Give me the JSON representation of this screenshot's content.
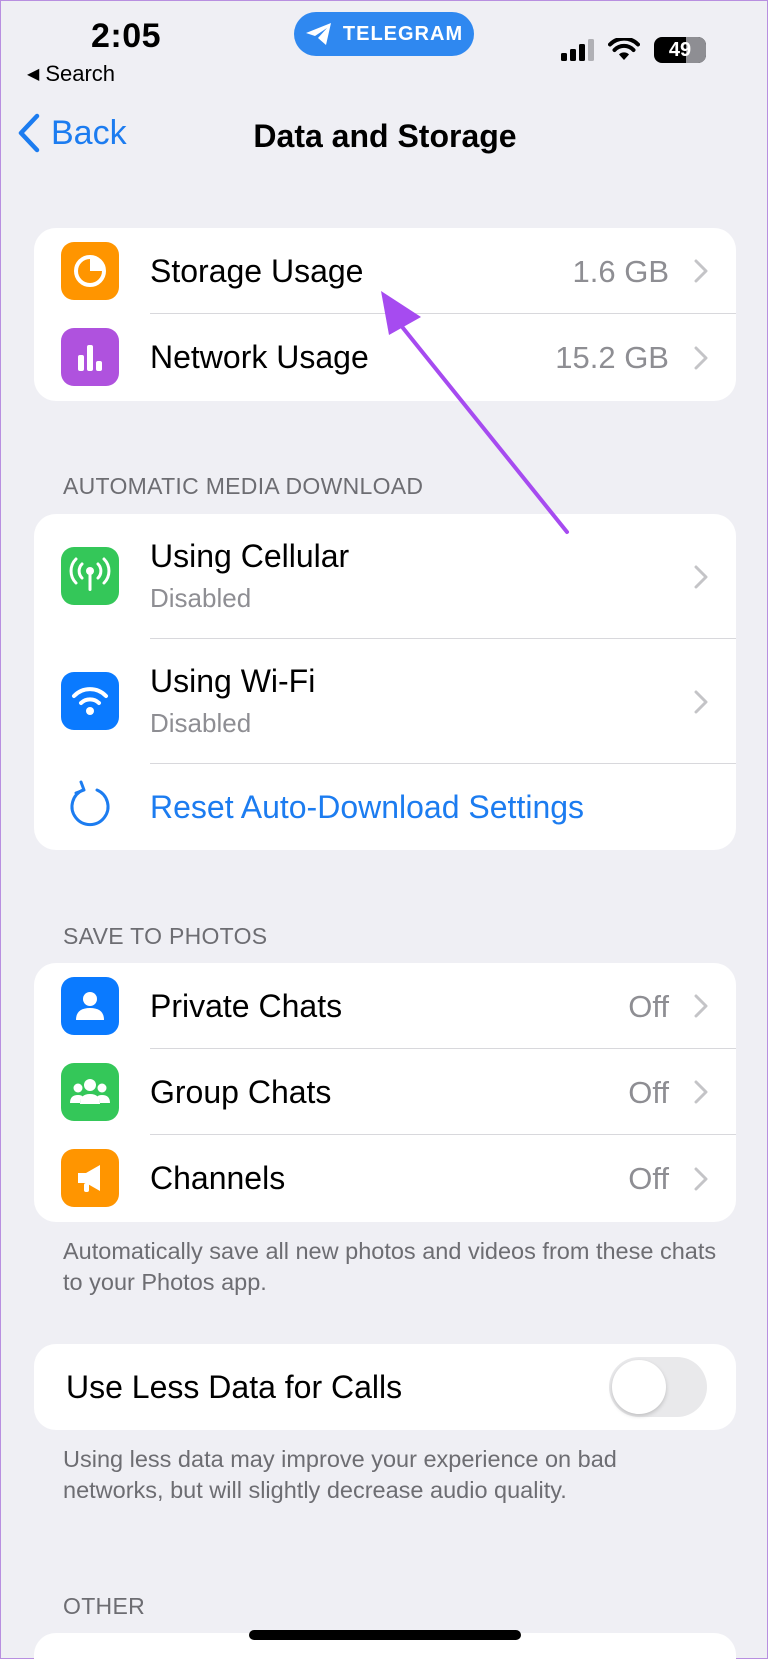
{
  "status_bar": {
    "time": "2:05",
    "back_to_app": "Search",
    "pill_label": "TELEGRAM",
    "battery": "49"
  },
  "nav": {
    "back_label": "Back",
    "title": "Data and Storage"
  },
  "usage": {
    "storage_label": "Storage Usage",
    "storage_value": "1.6 GB",
    "network_label": "Network Usage",
    "network_value": "15.2 GB"
  },
  "auto_download": {
    "header": "AUTOMATIC MEDIA DOWNLOAD",
    "cellular_label": "Using Cellular",
    "cellular_sub": "Disabled",
    "wifi_label": "Using Wi-Fi",
    "wifi_sub": "Disabled",
    "reset_label": "Reset Auto-Download Settings"
  },
  "save_to_photos": {
    "header": "SAVE TO PHOTOS",
    "private_label": "Private Chats",
    "private_value": "Off",
    "group_label": "Group Chats",
    "group_value": "Off",
    "channels_label": "Channels",
    "channels_value": "Off",
    "footnote": "Automatically save all new photos and videos from these chats to your Photos app."
  },
  "calls": {
    "label": "Use Less Data for Calls",
    "toggle_on": false,
    "footnote": "Using less data may improve your experience on bad networks, but will slightly decrease audio quality."
  },
  "other": {
    "header": "OTHER"
  },
  "colors": {
    "accent": "#1c7cf0",
    "storage_icon": "#ff9500",
    "network_icon": "#af52de",
    "cellular_icon": "#34c759",
    "wifi_icon": "#0a7aff",
    "private_icon": "#0a7aff",
    "group_icon": "#34c759",
    "channels_icon": "#ff9500",
    "annotation_arrow": "#a64bf0"
  }
}
